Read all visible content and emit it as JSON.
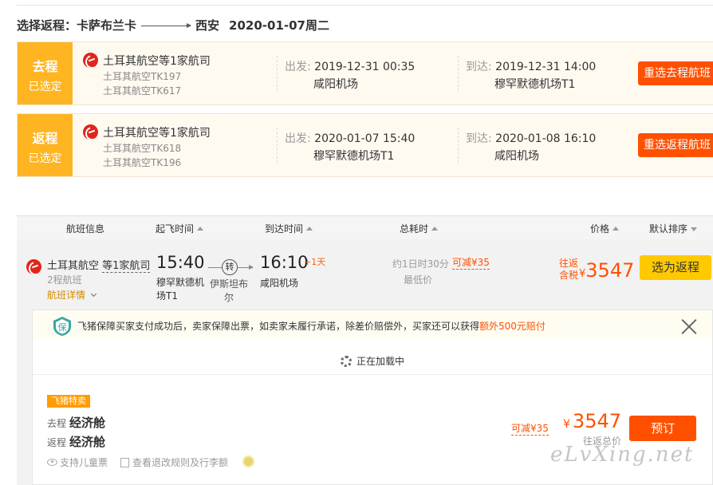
{
  "route": {
    "prefix": "选择返程：",
    "from": "卡萨布兰卡",
    "to": "西安",
    "date": "2020-01-07周二"
  },
  "selected": [
    {
      "tag_top": "去程",
      "tag_bottom": "已选定",
      "airline": "土耳其航空等1家航司",
      "flight_numbers": [
        "土耳其航空TK197",
        "土耳其航空TK617"
      ],
      "depart_label": "出发:",
      "depart_time": "2019-12-31 00:35",
      "depart_airport": "咸阳机场",
      "arrive_label": "到达:",
      "arrive_time": "2019-12-31 14:00",
      "arrive_airport": "穆罕默德机场T1",
      "reselect_label": "重选去程航班"
    },
    {
      "tag_top": "返程",
      "tag_bottom": "已选定",
      "airline": "土耳其航空等1家航司",
      "flight_numbers": [
        "土耳其航空TK618",
        "土耳其航空TK196"
      ],
      "depart_label": "出发:",
      "depart_time": "2020-01-07 15:40",
      "depart_airport": "穆罕默德机场T1",
      "arrive_label": "到达:",
      "arrive_time": "2020-01-08 16:10",
      "arrive_airport": "咸阳机场",
      "reselect_label": "重选返程航班"
    }
  ],
  "list_header": {
    "flight_info": "航班信息",
    "depart_time": "起飞时间",
    "arrive_time": "到达时间",
    "total_duration": "总耗时",
    "price": "价格",
    "default_sort": "默认排序"
  },
  "flight": {
    "airline_prefix": "土耳其航空 ",
    "airline_more": "等1家航司",
    "type": "2程航班",
    "detail_link": "航班详情",
    "depart_time": "15:40",
    "depart_airport": "穆罕默德机场T1",
    "transfer_icon": "转",
    "via": "伊斯坦布尔",
    "arrive_time": "16:10",
    "plus_day": "+1天",
    "arrive_airport": "咸阳机场",
    "duration": "约1日时30分",
    "lowest": "最低价",
    "discount": "可减¥35",
    "price_label": "往返含税",
    "price_currency": "¥",
    "price": "3547",
    "select_label": "选为返程"
  },
  "panel": {
    "guarantee_text": "飞猪保障买家支付成功后，卖家保障出票，如卖家未履行承诺，除差价赔偿外，买家还可以获得",
    "guarantee_highlight": "额外500元赔付",
    "shield_char": "保",
    "loading_text": "正在加载中",
    "badge": "飞猪特卖",
    "outbound_label": "去程",
    "outbound_cabin": "经济舱",
    "return_label": "返程",
    "return_cabin": "经济舱",
    "feature_children": "支持儿童票",
    "feature_rules": "查看退改规则及行李额",
    "discount": "可减¥35",
    "currency": "¥",
    "price": "3547",
    "price_label": "往返总价",
    "book_label": "预订"
  },
  "watermark": "eLvXing.net",
  "colors": {
    "accent_orange": "#ff5000",
    "tag_yellow": "#ffb422",
    "select_yellow": "#ffc900",
    "airline_red": "#e1251b"
  }
}
